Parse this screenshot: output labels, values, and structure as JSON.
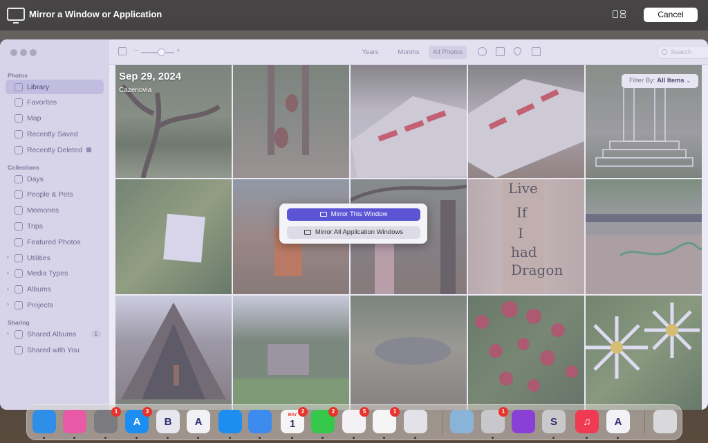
{
  "mirror_bar": {
    "title": "Mirror a Window or Application",
    "cancel_label": "Cancel"
  },
  "sidebar": {
    "sections": [
      {
        "heading": "Photos",
        "items": [
          {
            "label": "Library",
            "icon": "photo-library-icon",
            "selected": true
          },
          {
            "label": "Favorites",
            "icon": "heart-icon"
          },
          {
            "label": "Map",
            "icon": "map-icon"
          },
          {
            "label": "Recently Saved",
            "icon": "recently-saved-icon"
          },
          {
            "label": "Recently Deleted",
            "icon": "trash-icon",
            "locked": true
          }
        ]
      },
      {
        "heading": "Collections",
        "items": [
          {
            "label": "Days",
            "icon": "calendar-icon"
          },
          {
            "label": "People & Pets",
            "icon": "person-icon"
          },
          {
            "label": "Memories",
            "icon": "memories-icon"
          },
          {
            "label": "Trips",
            "icon": "suitcase-icon"
          },
          {
            "label": "Featured Photos",
            "icon": "featured-photos-icon"
          },
          {
            "label": "Utilities",
            "icon": "utilities-icon",
            "expandable": true
          },
          {
            "label": "Media Types",
            "icon": "media-types-icon",
            "expandable": true
          },
          {
            "label": "Albums",
            "icon": "albums-icon",
            "expandable": true
          },
          {
            "label": "Projects",
            "icon": "projects-icon",
            "expandable": true
          }
        ]
      },
      {
        "heading": "Sharing",
        "items": [
          {
            "label": "Shared Albums",
            "icon": "shared-albums-icon",
            "expandable": true,
            "count": "1"
          },
          {
            "label": "Shared with You",
            "icon": "shared-with-you-icon"
          }
        ]
      }
    ]
  },
  "toolbar": {
    "zoom_minus": "−",
    "zoom_plus": "+",
    "zoom_level": 0.6,
    "segments": [
      "Years",
      "Months",
      "All Photos"
    ],
    "active_segment": "All Photos",
    "search_placeholder": "Search"
  },
  "library": {
    "date": "Sep 29, 2024",
    "location": "Cazenovia",
    "filter_prefix": "Filter By:",
    "filter_value": "All Items"
  },
  "popup": {
    "mirror_window": "Mirror This Window",
    "mirror_all": "Mirror All Application Windows"
  },
  "dock": {
    "apps": [
      {
        "name": "finder-icon",
        "label": "",
        "color": "#2f8ee8"
      },
      {
        "name": "browser-icon",
        "label": "",
        "color": "#e85aa6"
      },
      {
        "name": "system-settings-icon",
        "label": "",
        "color": "#7a7a7f",
        "badge": "1"
      },
      {
        "name": "app-store-icon",
        "label": "A",
        "color": "#1c8ef2",
        "badge": "3"
      },
      {
        "name": "bbedit-icon",
        "label": "B",
        "color": "#e8e6ef"
      },
      {
        "name": "app-a-icon",
        "label": "A",
        "color": "#f2f1f5"
      },
      {
        "name": "safari-icon",
        "label": "",
        "color": "#1b8ef0"
      },
      {
        "name": "mail-icon",
        "label": "",
        "color": "#3e8bf0"
      },
      {
        "name": "calendar-icon",
        "label": "1",
        "color": "#f5f5f5",
        "badge": "2",
        "month": "MAY"
      },
      {
        "name": "messages-icon",
        "label": "",
        "color": "#35c84b",
        "badge": "2"
      },
      {
        "name": "slack-icon",
        "label": "",
        "color": "#f4f1f4",
        "badge": "5"
      },
      {
        "name": "photos-icon",
        "label": "",
        "color": "#f5f5f5",
        "badge": "1"
      },
      {
        "name": "iphone-mirroring-icon",
        "label": "",
        "color": "#e2e2e8"
      },
      {
        "name": "preview-icon",
        "label": "",
        "color": "#8ab3d8"
      },
      {
        "name": "automator-icon",
        "label": "",
        "color": "#c8c8cc",
        "badge": "1"
      },
      {
        "name": "affinity-icon",
        "label": "",
        "color": "#8a3fd6"
      },
      {
        "name": "scrobbles-icon",
        "label": "S",
        "color": "#c9c9cb"
      },
      {
        "name": "music-icon",
        "label": "♫",
        "color": "#f03a52"
      },
      {
        "name": "app-a2-icon",
        "label": "A",
        "color": "#f2f1f5"
      },
      {
        "name": "trash-icon",
        "label": "",
        "color": "#d9d9dc"
      }
    ]
  }
}
